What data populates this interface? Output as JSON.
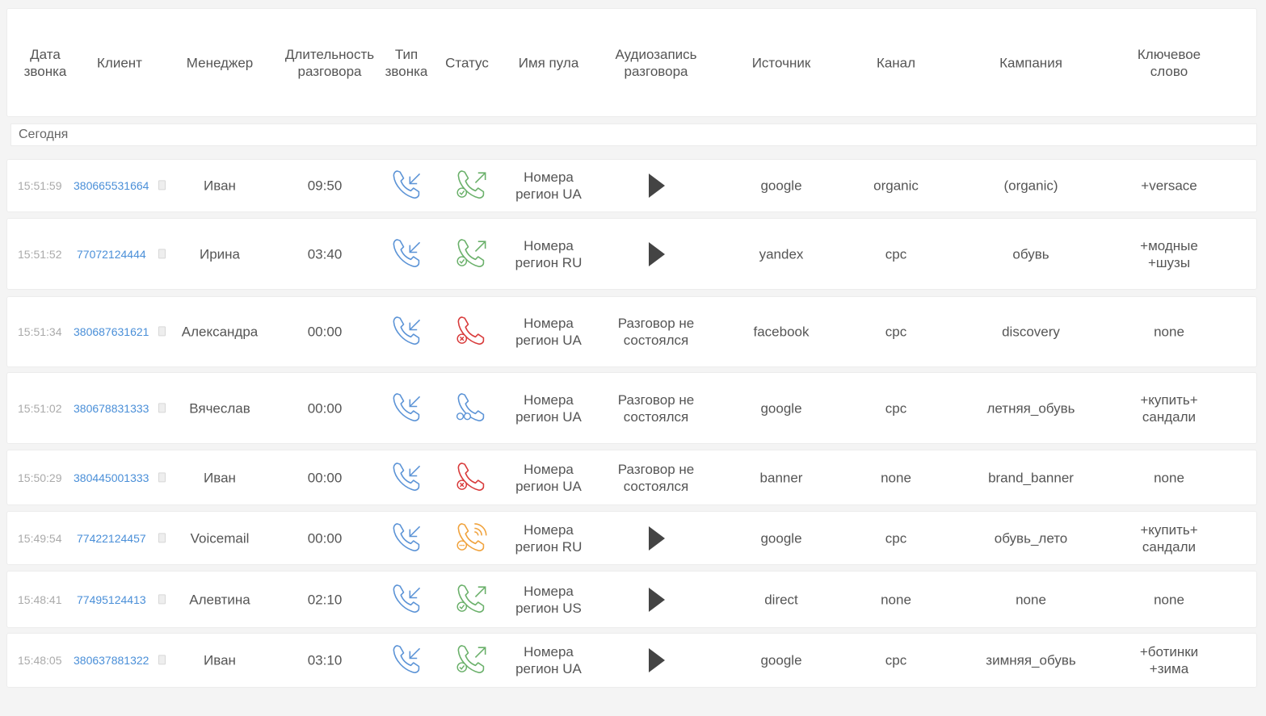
{
  "headers": {
    "date": "Дата\nзвонка",
    "client": "Клиент",
    "manager": "Менеджер",
    "duration": "Длительность\nразговора",
    "type": "Тип\nзвонка",
    "status": "Статус",
    "pool": "Имя пула",
    "record": "Аудиозапись\nразговора",
    "source": "Источник",
    "channel": "Канал",
    "campaign": "Кампания",
    "keyword": "Ключевое\nслово"
  },
  "group_label": "Сегодня",
  "colors": {
    "incoming": "#5b93d6",
    "answered": "#6ab06a",
    "missed": "#d83a3a",
    "voicemail": "#f0a23c",
    "busy": "#5b93d6",
    "link": "#4a8fd8"
  },
  "rows": [
    {
      "time": "15:51:59",
      "phone": "380665531664",
      "manager": "Иван",
      "duration": "09:50",
      "type_icon": "incoming-call-icon",
      "status": "answered",
      "status_icon": "answered-call-icon",
      "pool": "Номера\nрегион UA",
      "has_record": true,
      "record_text": "",
      "source": "google",
      "channel": "organic",
      "campaign": "(organic)",
      "keyword": "+versace"
    },
    {
      "time": "15:51:52",
      "phone": "77072124444",
      "manager": "Ирина",
      "duration": "03:40",
      "type_icon": "incoming-call-icon",
      "status": "answered",
      "status_icon": "answered-call-icon",
      "pool": "Номера\nрегион RU",
      "has_record": true,
      "record_text": "",
      "source": "yandex",
      "channel": "cpc",
      "campaign": "обувь",
      "keyword": "+модные\n+шузы"
    },
    {
      "time": "15:51:34",
      "phone": "380687631621",
      "manager": "Александра",
      "duration": "00:00",
      "type_icon": "incoming-call-icon",
      "status": "missed",
      "status_icon": "missed-call-icon",
      "pool": "Номера\nрегион UA",
      "has_record": false,
      "record_text": "Разговор не\nсостоялся",
      "source": "facebook",
      "channel": "cpc",
      "campaign": "discovery",
      "keyword": "none"
    },
    {
      "time": "15:51:02",
      "phone": "380678831333",
      "manager": "Вячеслав",
      "duration": "00:00",
      "type_icon": "incoming-call-icon",
      "status": "busy",
      "status_icon": "busy-call-icon",
      "pool": "Номера\nрегион UA",
      "has_record": false,
      "record_text": "Разговор не\nсостоялся",
      "source": "google",
      "channel": "cpc",
      "campaign": "летняя_обувь",
      "keyword": "+купить+\nсандали"
    },
    {
      "time": "15:50:29",
      "phone": "380445001333",
      "manager": "Иван",
      "duration": "00:00",
      "type_icon": "incoming-call-icon",
      "status": "missed",
      "status_icon": "missed-call-icon",
      "pool": "Номера\nрегион UA",
      "has_record": false,
      "record_text": "Разговор не\nсостоялся",
      "source": "banner",
      "channel": "none",
      "campaign": "brand_banner",
      "keyword": "none"
    },
    {
      "time": "15:49:54",
      "phone": "77422124457",
      "manager": "Voicemail",
      "duration": "00:00",
      "type_icon": "incoming-call-icon",
      "status": "voicemail",
      "status_icon": "voicemail-call-icon",
      "pool": "Номера\nрегион RU",
      "has_record": true,
      "record_text": "",
      "source": "google",
      "channel": "cpc",
      "campaign": "обувь_лето",
      "keyword": "+купить+\nсандали"
    },
    {
      "time": "15:48:41",
      "phone": "77495124413",
      "manager": "Алевтина",
      "duration": "02:10",
      "type_icon": "incoming-call-icon",
      "status": "answered",
      "status_icon": "answered-call-icon",
      "pool": "Номера\nрегион US",
      "has_record": true,
      "record_text": "",
      "source": "direct",
      "channel": "none",
      "campaign": "none",
      "keyword": "none"
    },
    {
      "time": "15:48:05",
      "phone": "380637881322",
      "manager": "Иван",
      "duration": "03:10",
      "type_icon": "incoming-call-icon",
      "status": "answered",
      "status_icon": "answered-call-icon",
      "pool": "Номера\nрегион UA",
      "has_record": true,
      "record_text": "",
      "source": "google",
      "channel": "cpc",
      "campaign": "зимняя_обувь",
      "keyword": "+ботинки\n+зима"
    }
  ]
}
